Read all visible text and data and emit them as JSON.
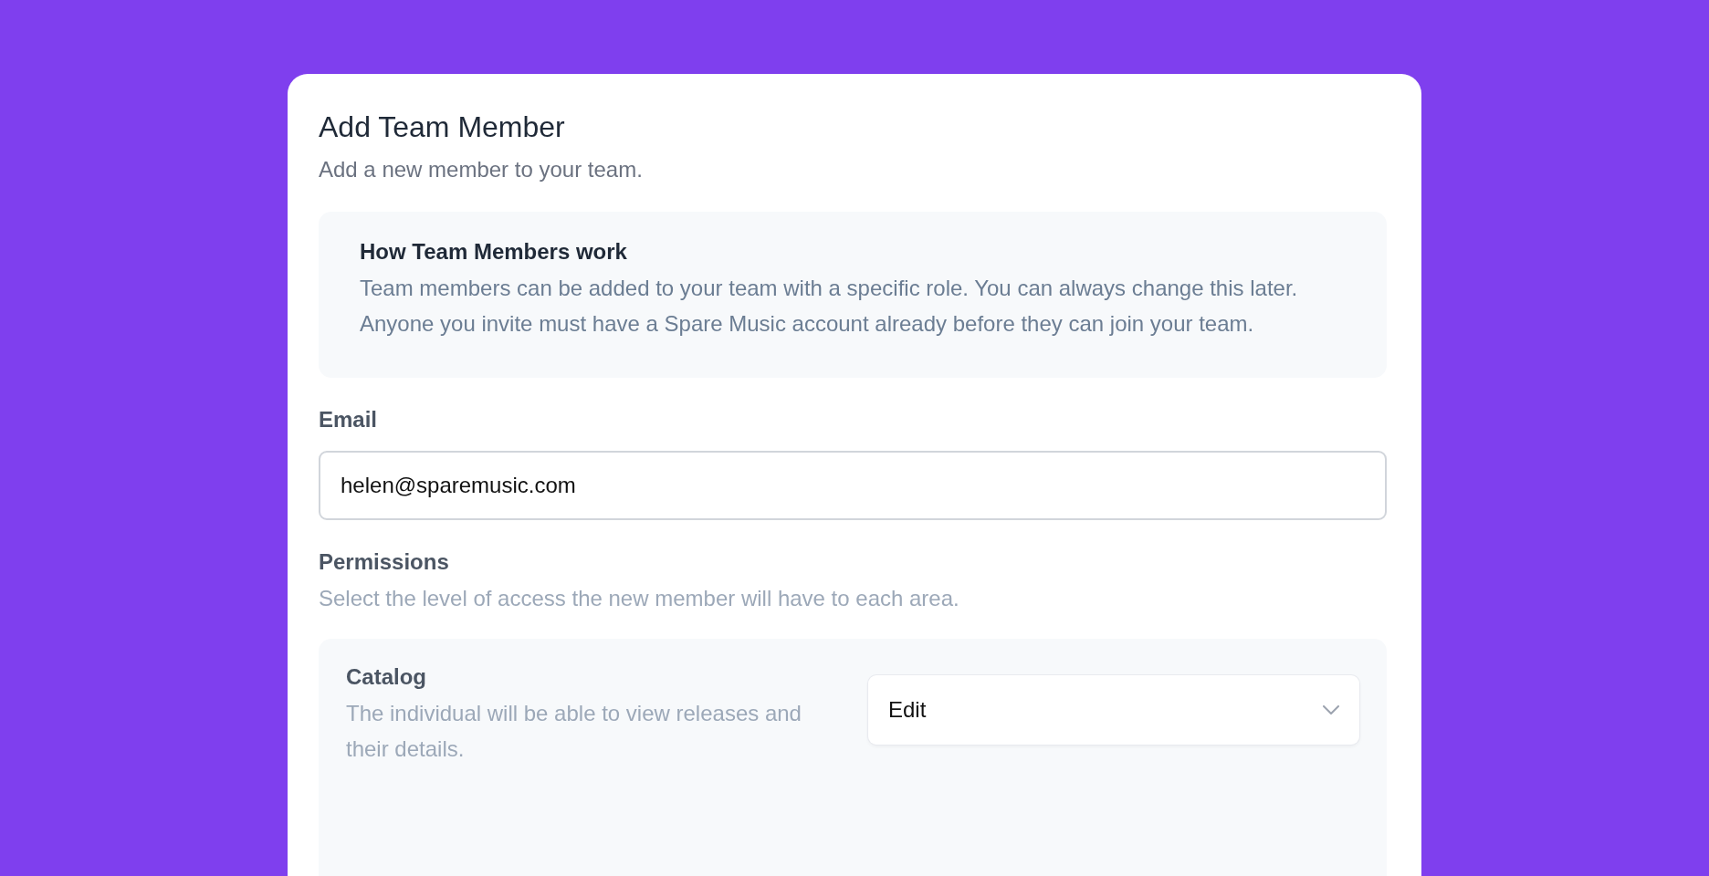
{
  "dialog": {
    "title": "Add Team Member",
    "subtitle": "Add a new member to your team."
  },
  "info": {
    "title": "How Team Members work",
    "body": "Team members can be added to your team with a specific role. You can always change this later. Anyone you invite must have a Spare Music account already before they can join your team."
  },
  "email": {
    "label": "Email",
    "value": "helen@sparemusic.com"
  },
  "permissions": {
    "label": "Permissions",
    "description": "Select the level of access the new member will have to each area.",
    "areas": [
      {
        "name": "Catalog",
        "description": "The individual will be able to view releases and their details.",
        "value": "Edit"
      }
    ]
  }
}
